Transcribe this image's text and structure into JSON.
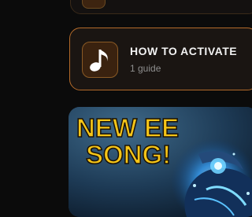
{
  "guide_card": {
    "title": "HOW TO ACTIVATE",
    "subtitle": "1 guide",
    "icon": "music-note-icon"
  },
  "video_card": {
    "thumbnail_text_line1": "NEW EE",
    "thumbnail_text_line2": "SONG!"
  },
  "colors": {
    "background": "#0b0b0b",
    "card_border_accent": "#b36a2a",
    "thumbnail_text": "#f5c518"
  }
}
